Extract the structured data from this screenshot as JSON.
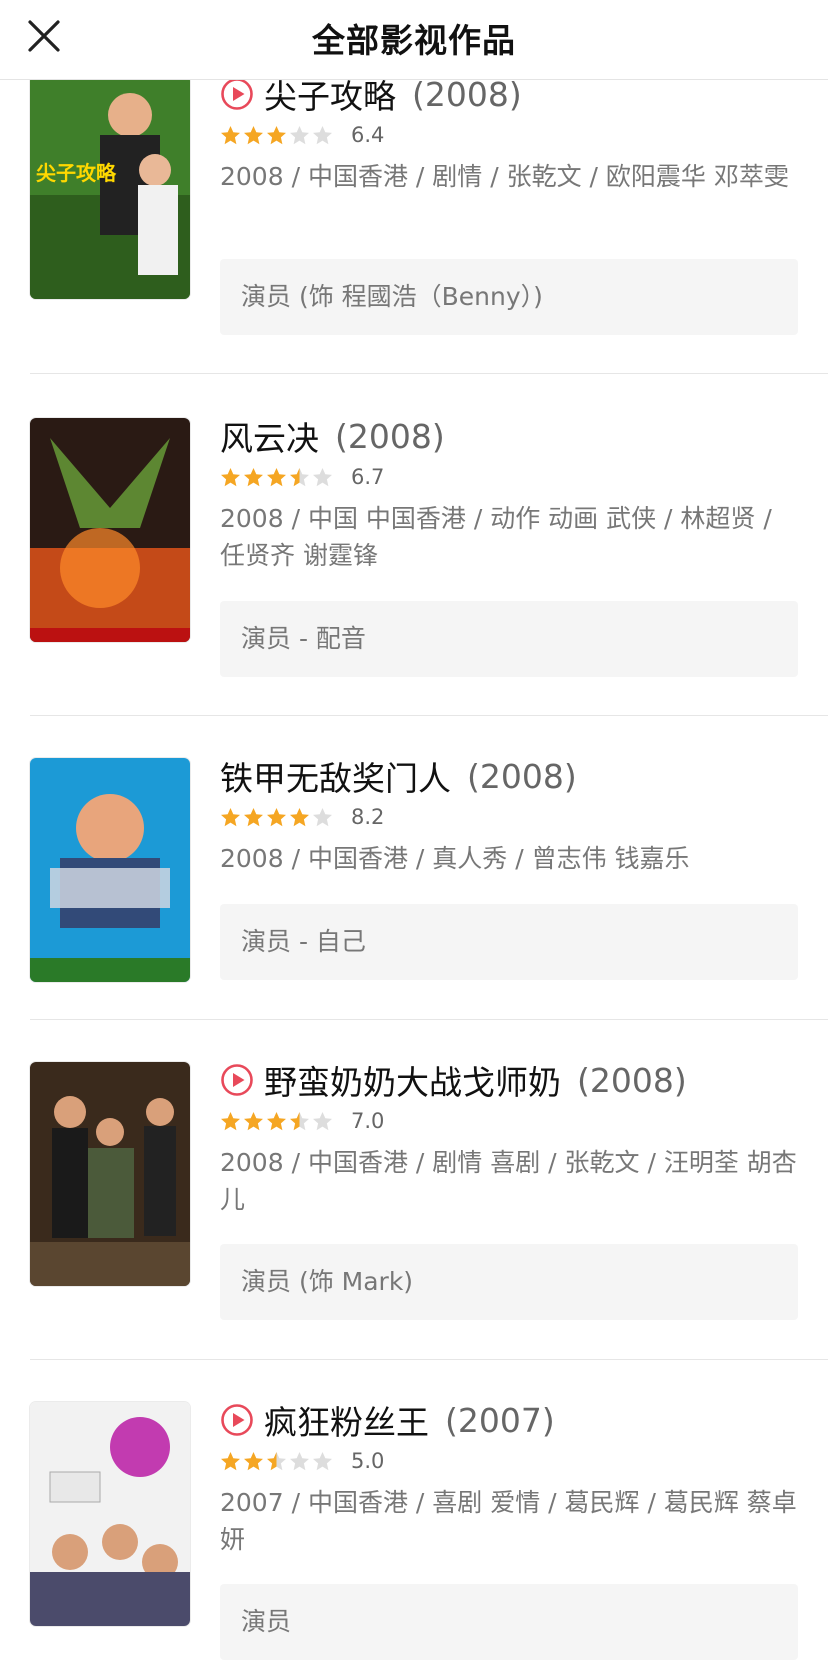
{
  "header": {
    "title": "全部影视作品",
    "close_icon": "close-icon"
  },
  "colors": {
    "star_on": "#F5A623",
    "star_off": "#DDDDDD",
    "play": "#E8495A"
  },
  "items": [
    {
      "title": "尖子攻略",
      "year": "(2008)",
      "has_play": true,
      "stars": 3,
      "rating": "6.4",
      "meta": "2008 / 中国香港 / 剧情 / 张乾文 / 欧阳震华 邓萃雯",
      "role": "演员 (饰 程國浩（Benny）)"
    },
    {
      "title": "风云决",
      "year": "(2008)",
      "has_play": false,
      "stars": 3.5,
      "rating": "6.7",
      "meta": "2008 / 中国 中国香港 / 动作 动画 武侠 / 林超贤 / 任贤齐 谢霆锋",
      "role": "演员 - 配音"
    },
    {
      "title": "铁甲无敌奖门人",
      "year": "(2008)",
      "has_play": false,
      "stars": 4,
      "rating": "8.2",
      "meta": "2008 / 中国香港 / 真人秀 / 曾志伟 钱嘉乐",
      "role": "演员 - 自己"
    },
    {
      "title": "野蛮奶奶大战戈师奶",
      "year": "(2008)",
      "has_play": true,
      "stars": 3.5,
      "rating": "7.0",
      "meta": "2008 / 中国香港 / 剧情 喜剧 / 张乾文 / 汪明荃 胡杏儿",
      "role": "演员 (饰 Mark)"
    },
    {
      "title": "疯狂粉丝王",
      "year": "(2007)",
      "has_play": true,
      "stars": 2.5,
      "rating": "5.0",
      "meta": "2007 / 中国香港 / 喜剧 爱情 / 葛民辉 / 葛民辉 蔡卓妍",
      "role": "演员"
    }
  ]
}
